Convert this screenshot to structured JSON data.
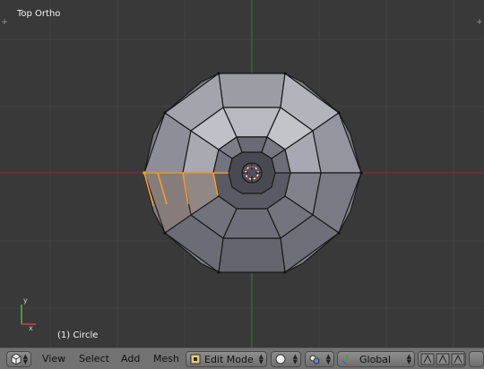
{
  "viewport": {
    "view_name": "Top Ortho",
    "object_label": "(1) Circle",
    "colors": {
      "background": "#393939",
      "face": "#8d8d95",
      "edge": "#1a1a1a",
      "x_axis": "#8a2a2a",
      "y_axis": "#2a7a2a",
      "selected": "#f0a030"
    }
  },
  "header": {
    "menus": [
      "View",
      "Select",
      "Add",
      "Mesh"
    ],
    "mode": "Edit Mode",
    "orientation": "Global",
    "icons": [
      "editor-type-icon",
      "viewport-shading-icon",
      "pivot-point-icon",
      "manipulator-icon",
      "layer-icon"
    ]
  }
}
